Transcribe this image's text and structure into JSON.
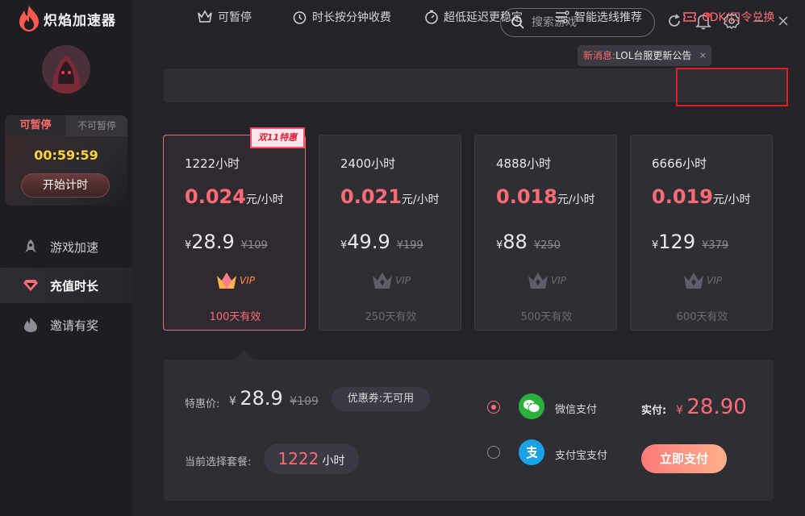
{
  "app": {
    "title": "炽焰加速器"
  },
  "sidebar": {
    "timer": {
      "tab_active": "可暂停",
      "tab_inactive": "不可暂停",
      "time": "00:59:59",
      "start_label": "开始计时"
    },
    "items": [
      {
        "label": "游戏加速",
        "icon": "rocket-icon"
      },
      {
        "label": "充值时长",
        "icon": "diamond-icon",
        "active": true
      },
      {
        "label": "邀请有奖",
        "icon": "flame-icon"
      }
    ]
  },
  "topbar": {
    "search_placeholder": "搜索游戏",
    "notice_prefix": "新消息:",
    "notice_text": "LOL台服更新公告",
    "notice_close": "×"
  },
  "features": [
    {
      "label": "可暂停",
      "icon": "crown-icon"
    },
    {
      "label": "时长按分钟收费",
      "icon": "clock-icon"
    },
    {
      "label": "超低延迟更稳定",
      "icon": "timer-icon"
    },
    {
      "label": "智能选线推荐",
      "icon": "route-icon"
    },
    {
      "label": "CDK/口令兑换",
      "icon": "ticket-icon"
    }
  ],
  "plans": [
    {
      "hours": "1222小时",
      "rate": "0.024",
      "rate_unit": "元/小时",
      "currency": "¥",
      "price": "28.9",
      "old_price": "¥109",
      "vip": "VIP",
      "valid": "100天有效",
      "selected": true,
      "badge": "双11特惠"
    },
    {
      "hours": "2400小时",
      "rate": "0.021",
      "rate_unit": "元/小时",
      "currency": "¥",
      "price": "49.9",
      "old_price": "¥199",
      "vip": "VIP",
      "valid": "250天有效"
    },
    {
      "hours": "4888小时",
      "rate": "0.018",
      "rate_unit": "元/小时",
      "currency": "¥",
      "price": "88",
      "old_price": "¥250",
      "vip": "VIP",
      "valid": "500天有效"
    },
    {
      "hours": "6666小时",
      "rate": "0.019",
      "rate_unit": "元/小时",
      "currency": "¥",
      "price": "129",
      "old_price": "¥379",
      "vip": "VIP",
      "valid": "600天有效"
    }
  ],
  "payment": {
    "special_label": "特惠价:",
    "currency": "¥",
    "special_price": "28.9",
    "special_old": "¥109",
    "coupon": "优惠券:无可用",
    "current_label": "当前选择套餐:",
    "current_value": "1222",
    "current_unit": "小时",
    "wechat_label": "微信支付",
    "alipay_label": "支付宝支付",
    "actual_label": "实付:",
    "actual_currency": "¥",
    "actual_amount": "28.90",
    "pay_button": "立即支付"
  },
  "colors": {
    "accent": "#ff6b75",
    "timer": "#ffd23f",
    "wechat": "#2ab13c",
    "alipay": "#1ba1e6",
    "highlight_box": "#e02020"
  }
}
